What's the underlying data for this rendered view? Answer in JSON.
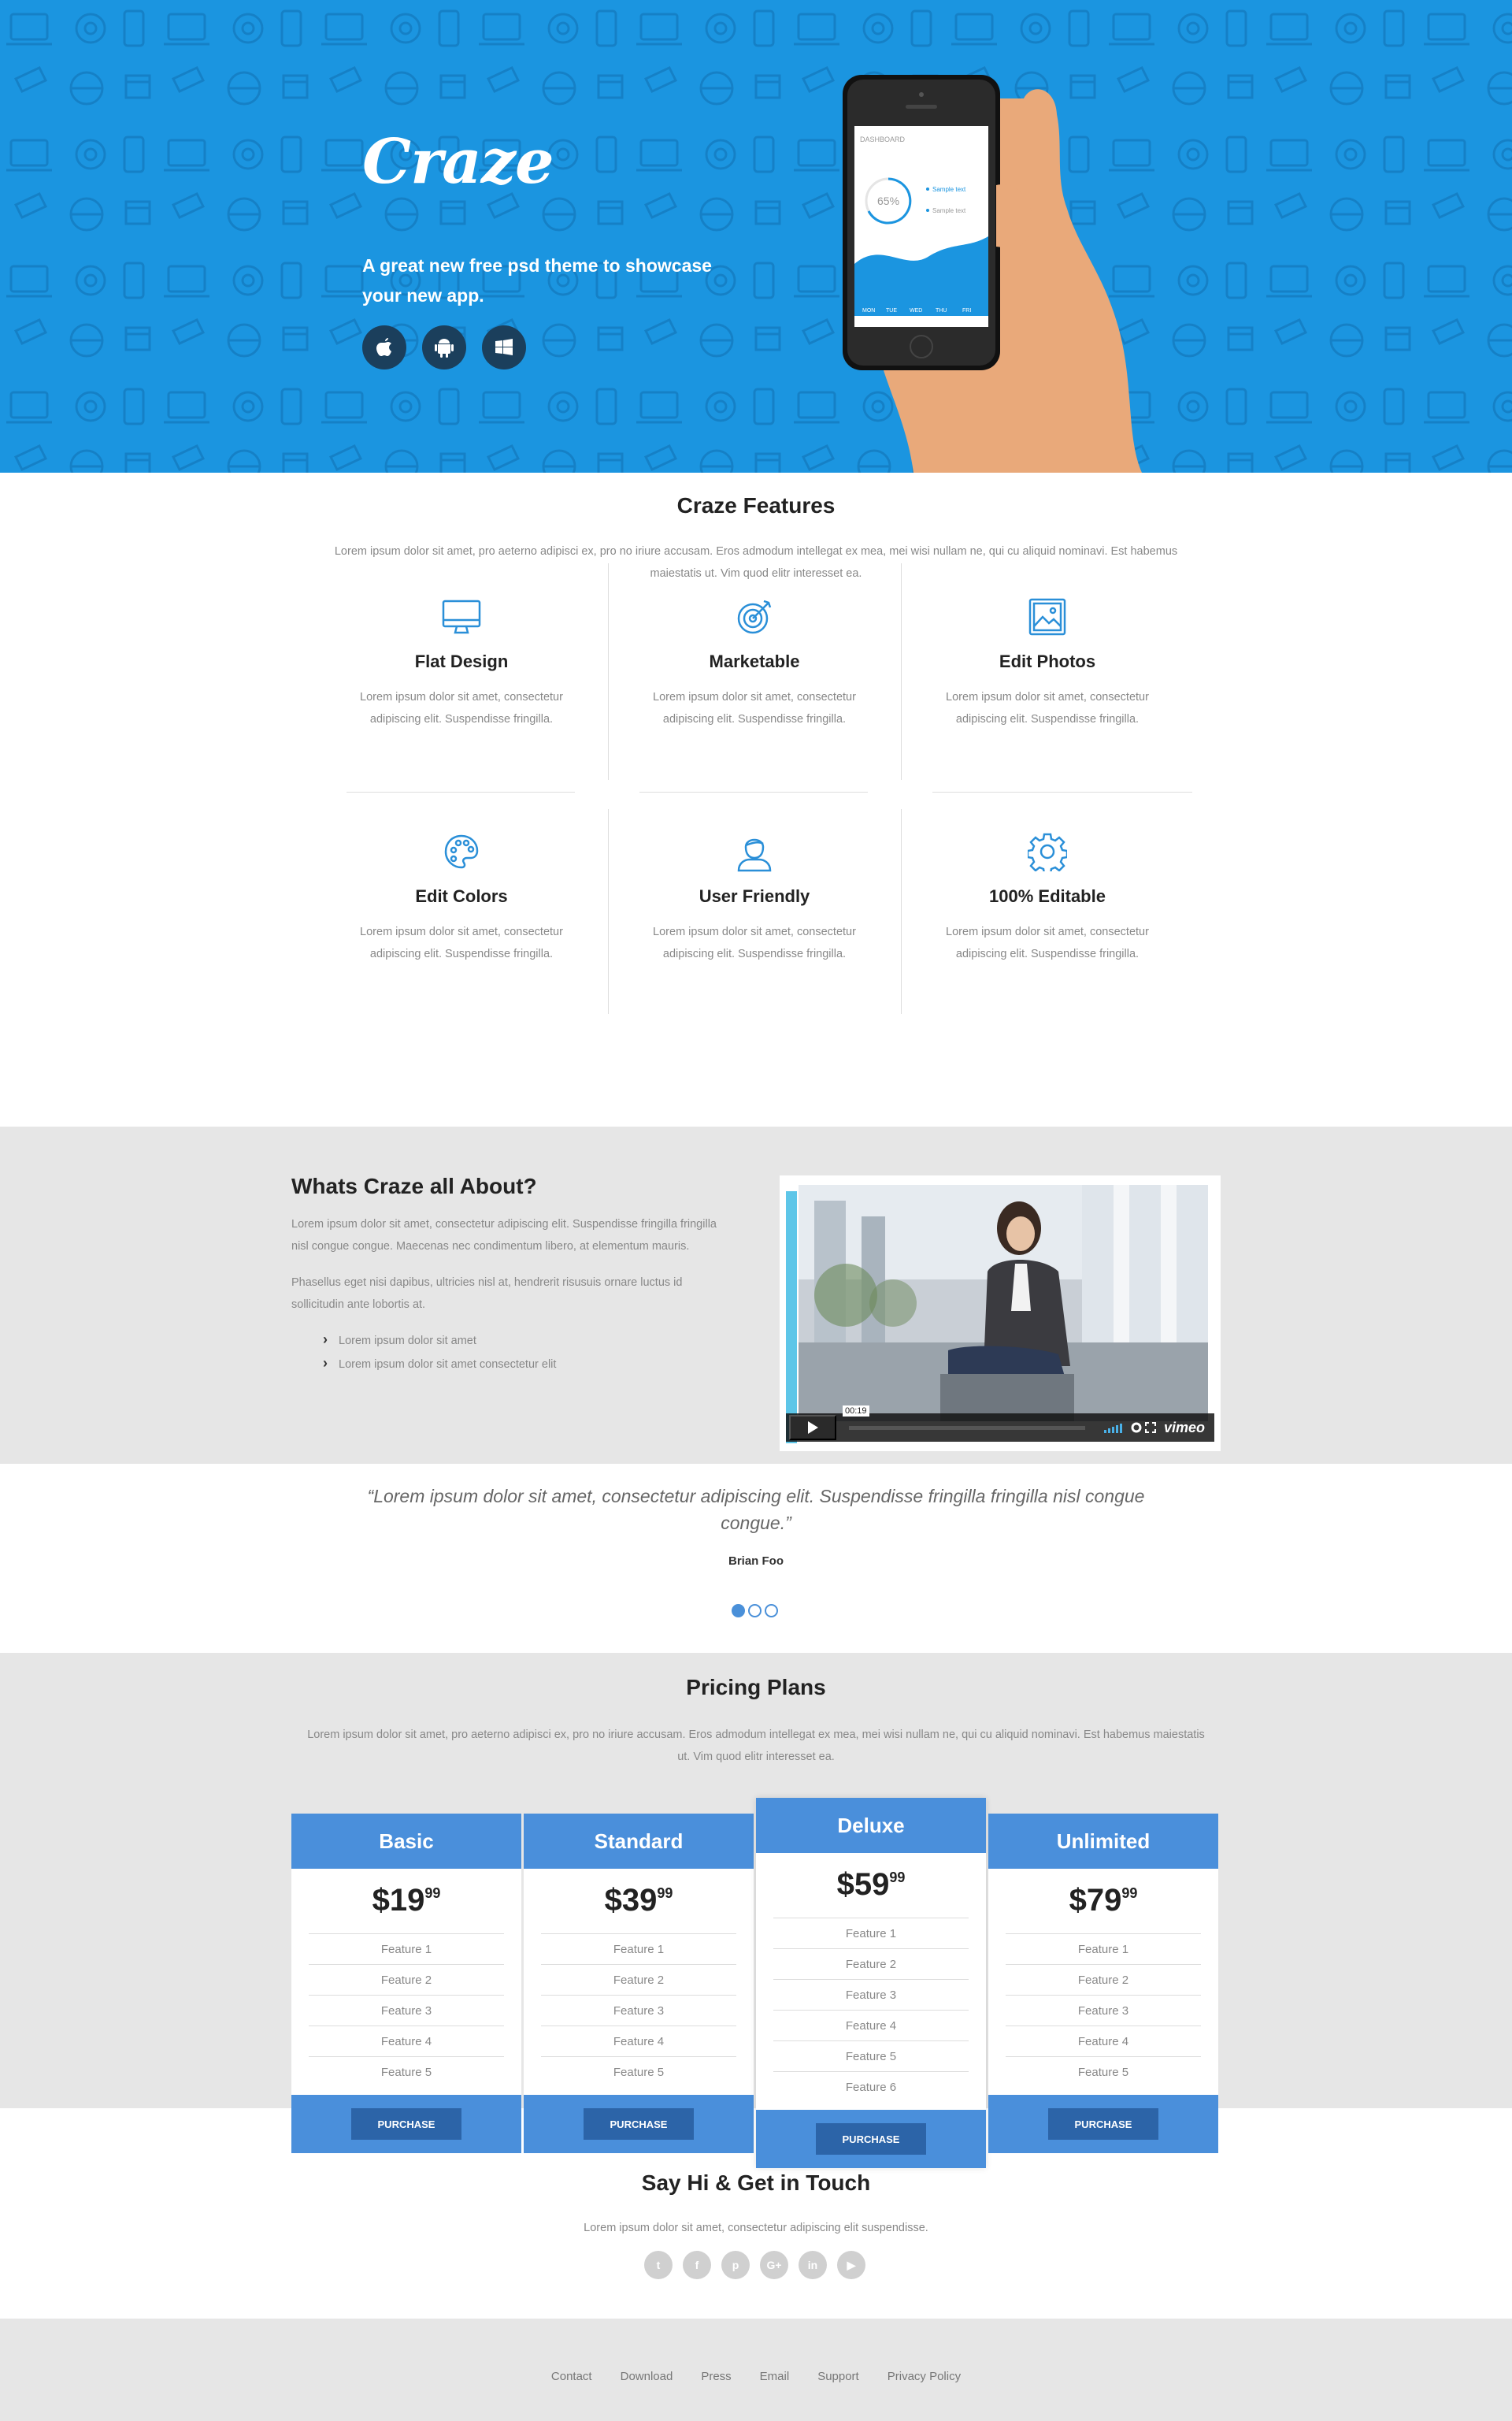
{
  "hero": {
    "logo": "Craze",
    "tagline": "A great new free psd theme to showcase your new app.",
    "store_icons": [
      "apple-icon",
      "android-icon",
      "windows-icon"
    ],
    "phone_screen": {
      "title": "DASHBOARD",
      "percent": "65%",
      "legend": [
        "Sample text",
        "Sample text"
      ],
      "days": [
        "MON",
        "TUE",
        "WED",
        "THU",
        "FRI"
      ]
    }
  },
  "features": {
    "title": "Craze Features",
    "intro": "Lorem ipsum dolor sit amet, pro aeterno adipisci ex, pro no iriure accusam. Eros admodum intellegat ex mea, mei wisi nullam ne, qui cu aliquid nominavi. Est habemus maiestatis ut. Vim quod elitr interesset ea.",
    "items": [
      {
        "icon": "monitor-icon",
        "title": "Flat Design",
        "text": "Lorem ipsum dolor sit amet, consectetur adipiscing elit. Suspendisse fringilla."
      },
      {
        "icon": "target-icon",
        "title": "Marketable",
        "text": "Lorem ipsum dolor sit amet, consectetur adipiscing elit. Suspendisse fringilla."
      },
      {
        "icon": "picture-icon",
        "title": "Edit Photos",
        "text": "Lorem ipsum dolor sit amet, consectetur adipiscing elit. Suspendisse fringilla."
      },
      {
        "icon": "palette-icon",
        "title": "Edit Colors",
        "text": "Lorem ipsum dolor sit amet, consectetur adipiscing elit. Suspendisse fringilla."
      },
      {
        "icon": "user-icon",
        "title": "User Friendly",
        "text": "Lorem ipsum dolor sit amet, consectetur adipiscing elit. Suspendisse fringilla."
      },
      {
        "icon": "gear-icon",
        "title": "100% Editable",
        "text": "Lorem ipsum dolor sit amet, consectetur adipiscing elit. Suspendisse fringilla."
      }
    ]
  },
  "about": {
    "title": "Whats Craze all About?",
    "para1": "Lorem ipsum dolor sit amet, consectetur adipiscing elit. Suspendisse fringilla fringilla nisl congue congue. Maecenas nec condimentum libero, at elementum mauris.",
    "para2": "Phasellus eget nisi dapibus, ultricies nisl at, hendrerit risusuis ornare luctus id sollicitudin ante lobortis at.",
    "list": [
      "Lorem ipsum dolor sit amet",
      "Lorem ipsum dolor sit amet consectetur elit"
    ],
    "video": {
      "time": "00:19",
      "brand": "vimeo"
    }
  },
  "testimonial": {
    "quote": "“Lorem ipsum dolor sit amet, consectetur adipiscing elit. Suspendisse fringilla fringilla nisl congue congue.”",
    "author": "Brian Foo",
    "slide_count": 3,
    "active_slide": 1
  },
  "pricing": {
    "title": "Pricing Plans",
    "intro": "Lorem ipsum dolor sit amet, pro aeterno adipisci ex, pro no iriure accusam. Eros admodum intellegat ex mea, mei wisi nullam ne, qui cu aliquid nominavi. Est habemus maiestatis ut. Vim quod elitr interesset ea.",
    "plans": [
      {
        "name": "Basic",
        "price": "$19",
        "cents": "99",
        "features": [
          "Feature 1",
          "Feature 2",
          "Feature 3",
          "Feature 4",
          "Feature 5"
        ],
        "button": "PURCHASE"
      },
      {
        "name": "Standard",
        "price": "$39",
        "cents": "99",
        "features": [
          "Feature 1",
          "Feature 2",
          "Feature 3",
          "Feature 4",
          "Feature 5"
        ],
        "button": "PURCHASE"
      },
      {
        "name": "Deluxe",
        "price": "$59",
        "cents": "99",
        "features": [
          "Feature 1",
          "Feature 2",
          "Feature 3",
          "Feature 4",
          "Feature 5",
          "Feature 6"
        ],
        "button": "PURCHASE",
        "featured": true
      },
      {
        "name": "Unlimited",
        "price": "$79",
        "cents": "99",
        "features": [
          "Feature 1",
          "Feature 2",
          "Feature 3",
          "Feature 4",
          "Feature 5"
        ],
        "button": "PURCHASE"
      }
    ]
  },
  "contact": {
    "title": "Say Hi & Get in Touch",
    "text": "Lorem ipsum dolor sit amet, consectetur adipiscing elit suspendisse.",
    "socials": [
      {
        "icon": "twitter-icon",
        "glyph": "t"
      },
      {
        "icon": "facebook-icon",
        "glyph": "f"
      },
      {
        "icon": "pinterest-icon",
        "glyph": "p"
      },
      {
        "icon": "google-plus-icon",
        "glyph": "G+"
      },
      {
        "icon": "linkedin-icon",
        "glyph": "in"
      },
      {
        "icon": "youtube-icon",
        "glyph": "▶"
      }
    ]
  },
  "footer": {
    "links": [
      "Contact",
      "Download",
      "Press",
      "Email",
      "Support",
      "Privacy Policy"
    ]
  },
  "colors": {
    "hero_blue": "#1b95e0",
    "accent_blue": "#4a8fdb",
    "button_blue": "#2c64a8",
    "gray_bg": "#e6e6e6"
  }
}
